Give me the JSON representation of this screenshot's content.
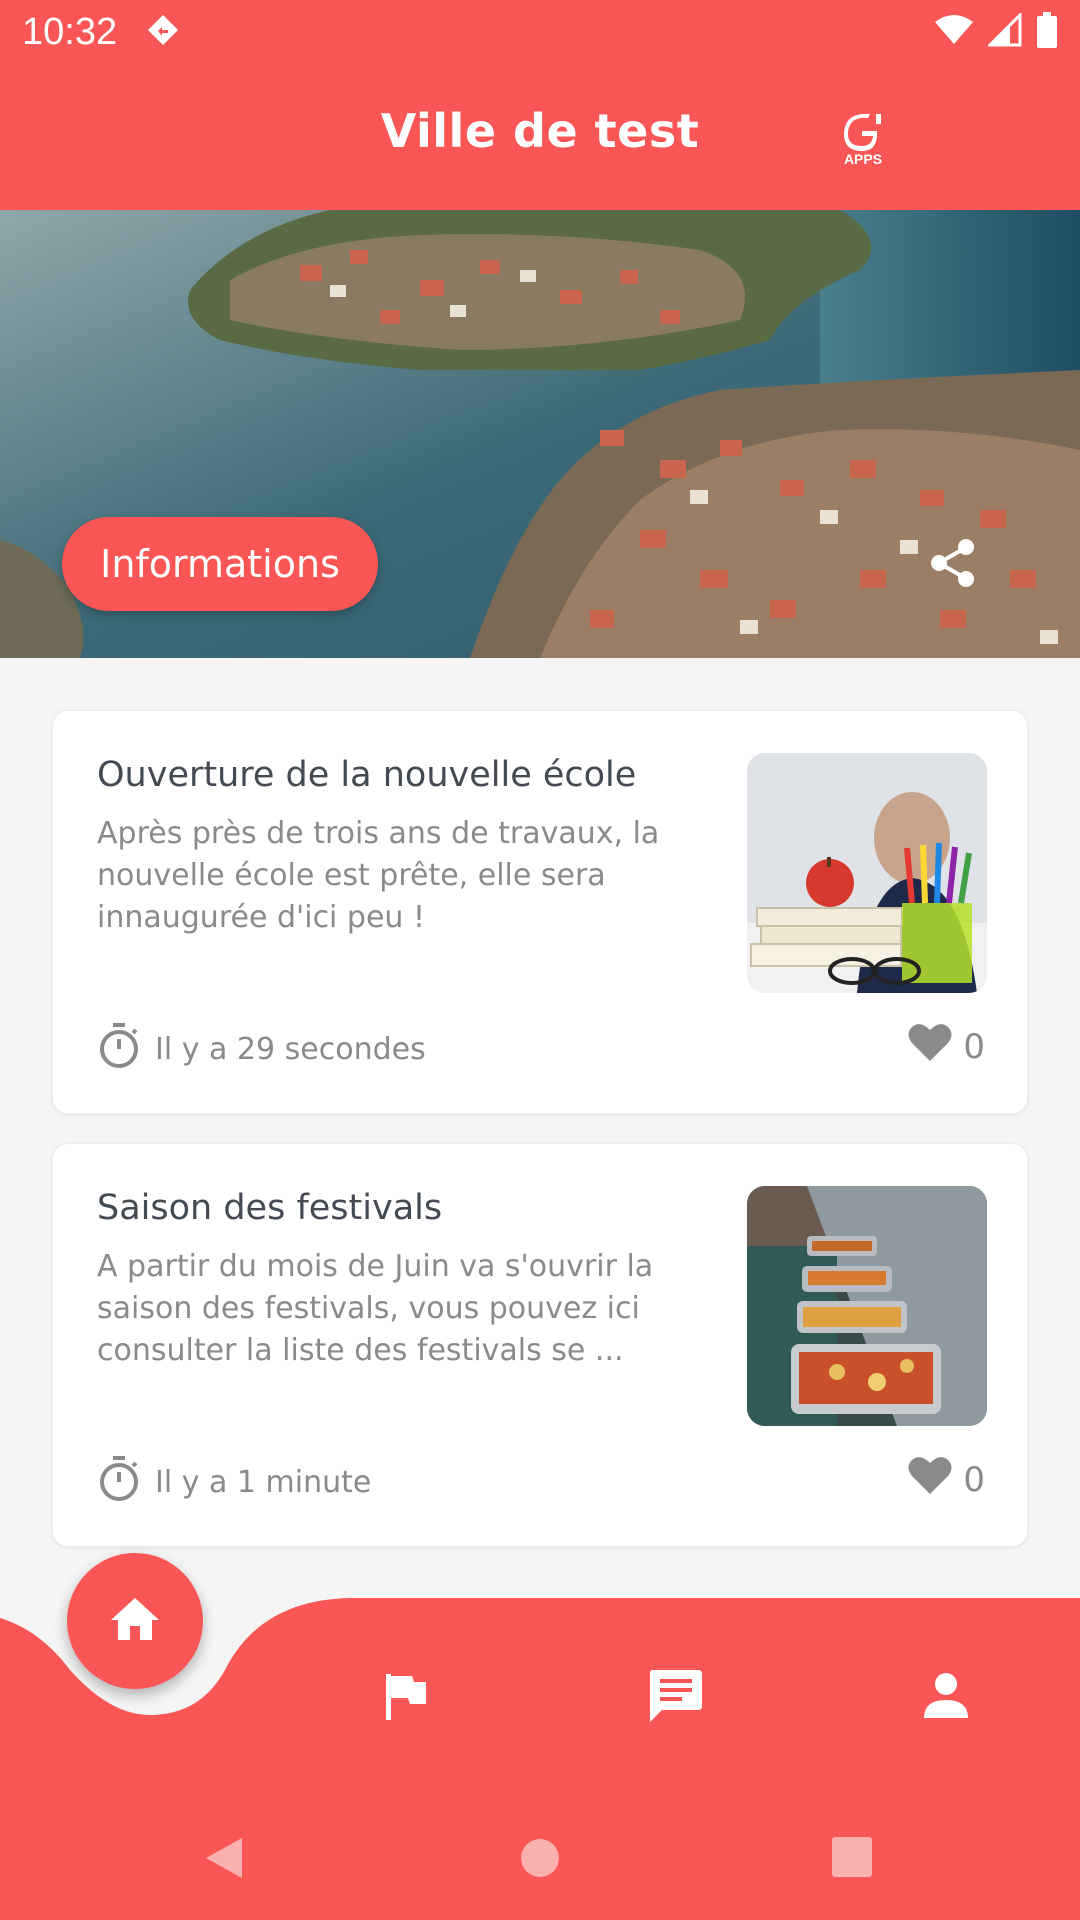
{
  "status_bar": {
    "time": "10:32",
    "icons": [
      "notification-app-icon",
      "wifi-icon",
      "signal-icon",
      "battery-icon"
    ]
  },
  "app_bar": {
    "title": "Ville de test",
    "logo_name": "g-apps-logo",
    "logo_text": "APPS"
  },
  "hero": {
    "info_button_label": "Informations",
    "share_icon": "share-icon"
  },
  "articles": [
    {
      "title": "Ouverture de la nouvelle école",
      "description": "Après près de trois ans de travaux, la nouvelle école est prête, elle sera innaugurée d'ici peu !",
      "time": "Il y a 29 secondes",
      "likes": "0",
      "thumbnail": "school-books-apple-pencils-image"
    },
    {
      "title": "Saison des festivals",
      "description": "A partir du mois de Juin va s'ouvrir la saison des festivals, vous pouvez ici consulter la liste des festivals se ...",
      "time": "Il y a 1 minute",
      "likes": "0",
      "thumbnail": "buffet-food-trays-image"
    }
  ],
  "bottom_nav": {
    "items": [
      {
        "icon": "home-icon",
        "active": true
      },
      {
        "icon": "flag-icon",
        "active": false
      },
      {
        "icon": "chat-icon",
        "active": false
      },
      {
        "icon": "person-icon",
        "active": false
      }
    ]
  },
  "colors": {
    "accent": "#fb5656",
    "text_dark": "#444a52",
    "text_muted": "#8a8a8a",
    "background": "#f5f5f5"
  }
}
